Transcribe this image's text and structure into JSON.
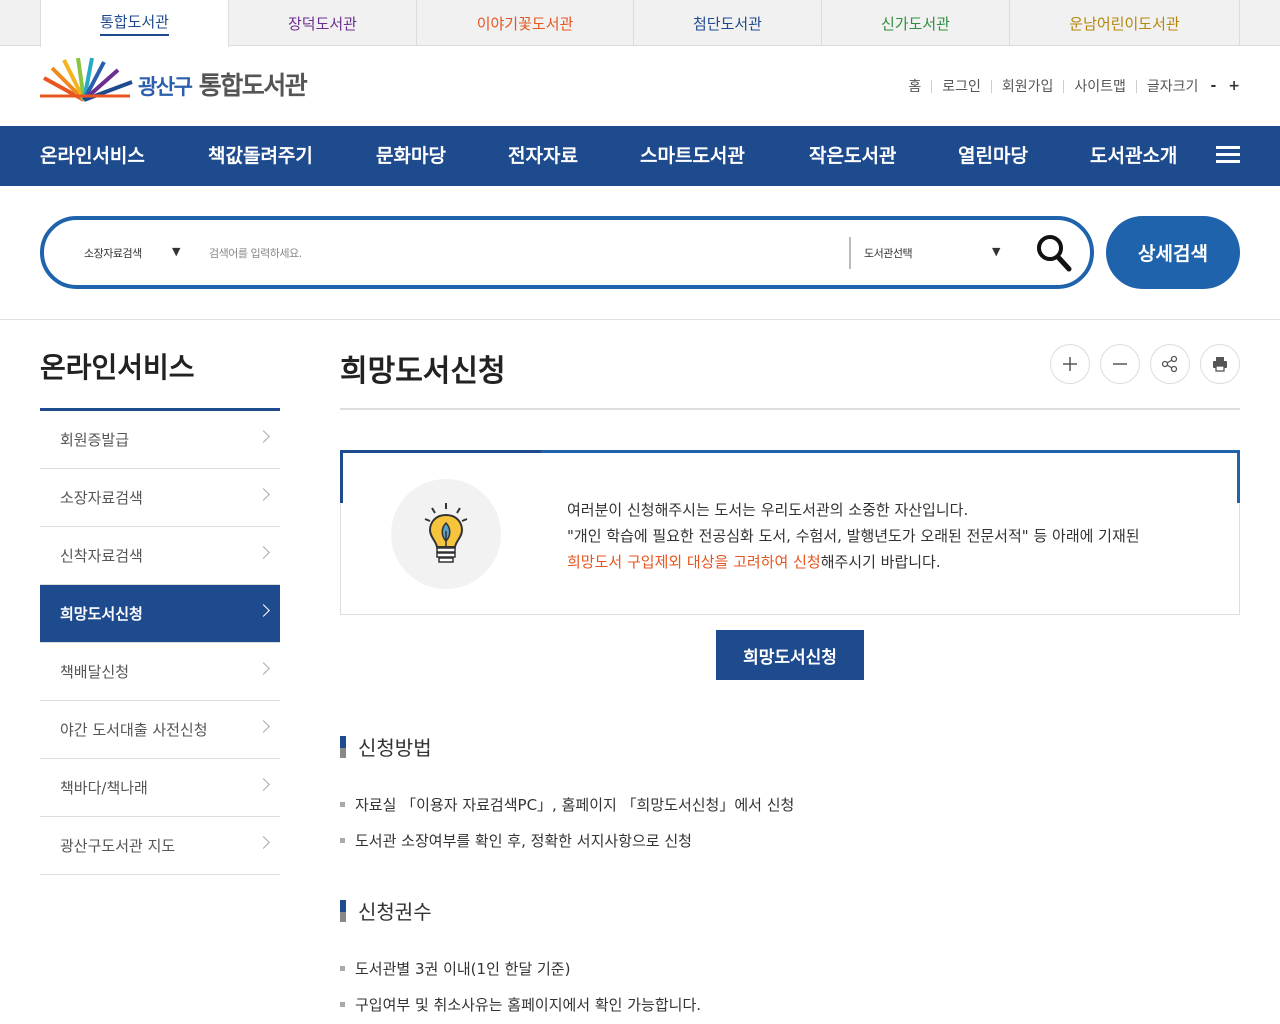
{
  "library_tabs": [
    {
      "label": "통합도서관",
      "color": "#1e4a8e",
      "active": true
    },
    {
      "label": "장덕도서관",
      "color": "#6b2f8f"
    },
    {
      "label": "이야기꽃도서관",
      "color": "#e8551f"
    },
    {
      "label": "첨단도서관",
      "color": "#1e4a8e"
    },
    {
      "label": "신가도서관",
      "color": "#2f8f3e"
    },
    {
      "label": "운남어린이도서관",
      "color": "#b5860b"
    }
  ],
  "logo": {
    "part1": "광산구",
    "part2": "통합도서관"
  },
  "util": {
    "home": "홈",
    "login": "로그인",
    "join": "회원가입",
    "sitemap": "사이트맵",
    "font_size": "글자크기",
    "minus": "-",
    "plus": "+"
  },
  "gnb": [
    "온라인서비스",
    "책값돌려주기",
    "문화마당",
    "전자자료",
    "스마트도서관",
    "작은도서관",
    "열린마당",
    "도서관소개"
  ],
  "search": {
    "type_select": "소장자료검색",
    "placeholder": "검색어를 입력하세요.",
    "library_select": "도서관선택",
    "advanced": "상세검색"
  },
  "lnb": {
    "title": "온라인서비스",
    "items": [
      "회원증발급",
      "소장자료검색",
      "신착자료검색",
      "희망도서신청",
      "책배달신청",
      "야간 도서대출 사전신청",
      "책바다/책나래",
      "광산구도서관 지도"
    ],
    "active_index": 3
  },
  "content": {
    "title": "희망도서신청",
    "info_line1": "여러분이 신청해주시는 도서는 우리도서관의 소중한 자산입니다.",
    "info_line2": "\"개인 학습에 필요한 전공심화 도서, 수험서, 발행년도가 오래된 전문서적\" 등 아래에 기재된",
    "info_line3_red": "희망도서 구입제외 대상을 고려하여 신청",
    "info_line3_rest": "해주시기 바랍니다.",
    "apply_button": "희망도서신청",
    "section1_title": "신청방법",
    "section1_items": [
      "자료실 「이용자 자료검색PC」, 홈페이지 「희망도서신청」에서 신청",
      "도서관 소장여부를 확인 후, 정확한 서지사항으로 신청"
    ],
    "section2_title": "신청권수",
    "section2_items": [
      "도서관별 3권 이내(1인 한달 기준)",
      "구입여부 및 취소사유는 홈페이지에서 확인 가능합니다."
    ]
  },
  "colors": {
    "primary": "#1e4a8e",
    "search": "#1f63ad",
    "accent_red": "#e8551f"
  }
}
